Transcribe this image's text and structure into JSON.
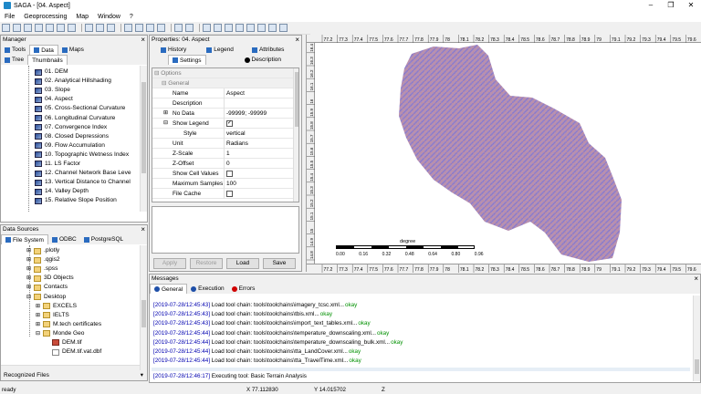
{
  "title": "SAGA - [04. Aspect]",
  "window_controls": [
    "–",
    "❐",
    "✕"
  ],
  "menu": [
    "File",
    "Geoprocessing",
    "Map",
    "Window",
    "?"
  ],
  "manager": {
    "title": "Manager",
    "tabs": [
      "Tools",
      "Data",
      "Maps"
    ],
    "subtabs": [
      "Tree",
      "Thumbnails"
    ],
    "items": [
      "01. DEM",
      "02. Analytical Hillshading",
      "03. Slope",
      "04. Aspect",
      "05. Cross-Sectional Curvature",
      "06. Longitudinal Curvature",
      "07. Convergence Index",
      "08. Closed Depressions",
      "09. Flow Accumulation",
      "10. Topographic Wetness Index",
      "11. LS Factor",
      "12. Channel Network Base Leve",
      "13. Vertical Distance to Channel",
      "14. Valley Depth",
      "15. Relative Slope Position"
    ]
  },
  "properties": {
    "title": "Properties: 04. Aspect",
    "tabs": [
      "History",
      "Legend",
      "Attributes",
      "Settings",
      "Description"
    ],
    "cat_options": "Options",
    "cat_general": "General",
    "rows": [
      {
        "name": "Name",
        "value": "Aspect"
      },
      {
        "name": "Description",
        "value": ""
      },
      {
        "name": "No Data",
        "value": "-99999; -99999"
      },
      {
        "name": "Show Legend",
        "value": "✓"
      },
      {
        "name": "Style",
        "value": "vertical"
      },
      {
        "name": "Unit",
        "value": "Radians"
      },
      {
        "name": "Z-Scale",
        "value": "1"
      },
      {
        "name": "Z-Offset",
        "value": "0"
      },
      {
        "name": "Show Cell Values",
        "value": ""
      },
      {
        "name": "Maximum Samples",
        "value": "100"
      },
      {
        "name": "File Cache",
        "value": ""
      }
    ],
    "buttons": {
      "apply": "Apply",
      "restore": "Restore",
      "load": "Load",
      "save": "Save"
    }
  },
  "data_sources": {
    "title": "Data Sources",
    "tabs": [
      "File System",
      "ODBC",
      "PostgreSQL"
    ],
    "items": [
      ".plotly",
      ".qgis2",
      ".spss",
      "3D Objects",
      "Contacts",
      "Desktop",
      "EXCELS",
      "IELTS",
      "M.tech certificates",
      "Monde Geo",
      "DEM.tif",
      "DEM.tif.vat.dbf"
    ],
    "footer": "Recognized Files"
  },
  "map": {
    "ruler_top": [
      "77.2",
      "77.3",
      "77.4",
      "77.5",
      "77.6",
      "77.7",
      "77.8",
      "77.9",
      "78",
      "78.1",
      "78.2",
      "78.3",
      "78.4",
      "78.5",
      "78.6",
      "78.7",
      "78.8",
      "78.9",
      "79",
      "79.1",
      "79.2",
      "79.3",
      "79.4",
      "79.5",
      "79.6"
    ],
    "ruler_left": [
      "14.8",
      "14.9",
      "15",
      "15.1",
      "15.2",
      "15.3",
      "15.4",
      "15.5",
      "15.6",
      "15.7",
      "15.8",
      "15.9",
      "16",
      "16.1",
      "16.2",
      "16.3",
      "16.4"
    ],
    "scale_unit": "degree",
    "scale_ticks": [
      "0.00",
      "0.16",
      "0.32",
      "0.48",
      "0.64",
      "0.80",
      "0.96"
    ]
  },
  "messages": {
    "title": "Messages",
    "tabs": [
      "General",
      "Execution",
      "Errors"
    ],
    "lines": [
      {
        "date": "[2019-07-28/12:45:43]",
        "text": "Load tool chain: tools\\toolchains\\imagery_tcsc.xml...",
        "ok": "okay"
      },
      {
        "date": "[2019-07-28/12:45:43]",
        "text": "Load tool chain: tools\\toolchains\\tbis.xml...",
        "ok": "okay"
      },
      {
        "date": "[2019-07-28/12:45:43]",
        "text": "Load tool chain: tools\\toolchains\\import_text_tables.xml...",
        "ok": "okay"
      },
      {
        "date": "[2019-07-28/12:45:44]",
        "text": "Load tool chain: tools\\toolchains\\temperature_downscaling.xml...",
        "ok": "okay"
      },
      {
        "date": "[2019-07-28/12:45:44]",
        "text": "Load tool chain: tools\\toolchains\\temperature_downscaling_bulk.xml...",
        "ok": "okay"
      },
      {
        "date": "[2019-07-28/12:45:44]",
        "text": "Load tool chain: tools\\toolchains\\tta_LandCover.xml...",
        "ok": "okay"
      },
      {
        "date": "[2019-07-28/12:45:44]",
        "text": "Load tool chain: tools\\toolchains\\tta_TravelTime.xml...",
        "ok": "okay"
      }
    ],
    "last": {
      "date": "[2019-07-28/12:46:17]",
      "text": "Executing tool: Basic Terrain Analysis"
    }
  },
  "status": {
    "ready": "ready",
    "x": "X 77.112830",
    "y": "Y 14.015702",
    "z": "Z"
  }
}
